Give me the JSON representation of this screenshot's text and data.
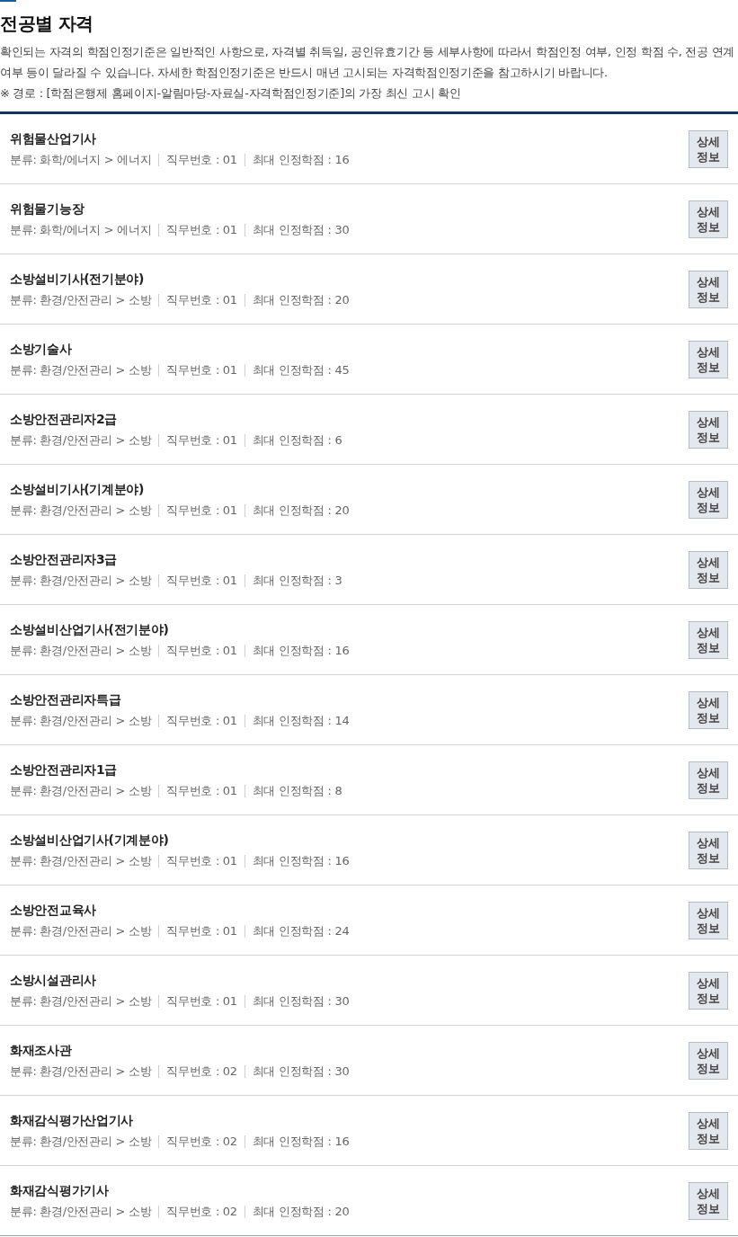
{
  "header": {
    "title": "전공별 자격",
    "description": "확인되는 자격의 학점인정기준은 일반적인 사항으로, 자격별 취득일, 공인유효기간 등 세부사항에 따라서 학점인정 여부, 인정 학점 수, 전공 연계 여부 등이 달라질 수 있습니다. 자세한 학점인정기준은 반드시 매년 고시되는 자격학점인정기준을 참고하시기 바랍니다.",
    "note": "※ 경로 : [학점은행제 홈페이지-알림마당-자료실-자격학점인정기준]의 가장 최신 고시 확인"
  },
  "certificates": [
    {
      "name": "위험물산업기사",
      "category": "분류: 화학/에너지 > 에너지",
      "job_number": "직무번호 : 01",
      "max_credits": "최대 인정학점 : 16",
      "button": "상세 정보"
    },
    {
      "name": "위험물기능장",
      "category": "분류: 화학/에너지 > 에너지",
      "job_number": "직무번호 : 01",
      "max_credits": "최대 인정학점 : 30",
      "button": "상세 정보"
    },
    {
      "name": "소방설비기사(전기분야)",
      "category": "분류: 환경/안전관리 > 소방",
      "job_number": "직무번호 : 01",
      "max_credits": "최대 인정학점 : 20",
      "button": "상세 정보"
    },
    {
      "name": "소방기술사",
      "category": "분류: 환경/안전관리 > 소방",
      "job_number": "직무번호 : 01",
      "max_credits": "최대 인정학점 : 45",
      "button": "상세 정보"
    },
    {
      "name": "소방안전관리자2급",
      "category": "분류: 환경/안전관리 > 소방",
      "job_number": "직무번호 : 01",
      "max_credits": "최대 인정학점 : 6",
      "button": "상세 정보"
    },
    {
      "name": "소방설비기사(기계분야)",
      "category": "분류: 환경/안전관리 > 소방",
      "job_number": "직무번호 : 01",
      "max_credits": "최대 인정학점 : 20",
      "button": "상세 정보"
    },
    {
      "name": "소방안전관리자3급",
      "category": "분류: 환경/안전관리 > 소방",
      "job_number": "직무번호 : 01",
      "max_credits": "최대 인정학점 : 3",
      "button": "상세 정보"
    },
    {
      "name": "소방설비산업기사(전기분야)",
      "category": "분류: 환경/안전관리 > 소방",
      "job_number": "직무번호 : 01",
      "max_credits": "최대 인정학점 : 16",
      "button": "상세 정보"
    },
    {
      "name": "소방안전관리자특급",
      "category": "분류: 환경/안전관리 > 소방",
      "job_number": "직무번호 : 01",
      "max_credits": "최대 인정학점 : 14",
      "button": "상세 정보"
    },
    {
      "name": "소방안전관리자1급",
      "category": "분류: 환경/안전관리 > 소방",
      "job_number": "직무번호 : 01",
      "max_credits": "최대 인정학점 : 8",
      "button": "상세 정보"
    },
    {
      "name": "소방설비산업기사(기계분야)",
      "category": "분류: 환경/안전관리 > 소방",
      "job_number": "직무번호 : 01",
      "max_credits": "최대 인정학점 : 16",
      "button": "상세 정보"
    },
    {
      "name": "소방안전교육사",
      "category": "분류: 환경/안전관리 > 소방",
      "job_number": "직무번호 : 01",
      "max_credits": "최대 인정학점 : 24",
      "button": "상세 정보"
    },
    {
      "name": "소방시설관리사",
      "category": "분류: 환경/안전관리 > 소방",
      "job_number": "직무번호 : 01",
      "max_credits": "최대 인정학점 : 30",
      "button": "상세 정보"
    },
    {
      "name": "화재조사관",
      "category": "분류: 환경/안전관리 > 소방",
      "job_number": "직무번호 : 02",
      "max_credits": "최대 인정학점 : 30",
      "button": "상세 정보"
    },
    {
      "name": "화재감식평가산업기사",
      "category": "분류: 환경/안전관리 > 소방",
      "job_number": "직무번호 : 02",
      "max_credits": "최대 인정학점 : 16",
      "button": "상세 정보"
    },
    {
      "name": "화재감식평가기사",
      "category": "분류: 환경/안전관리 > 소방",
      "job_number": "직무번호 : 02",
      "max_credits": "최대 인정학점 : 20",
      "button": "상세 정보"
    }
  ]
}
